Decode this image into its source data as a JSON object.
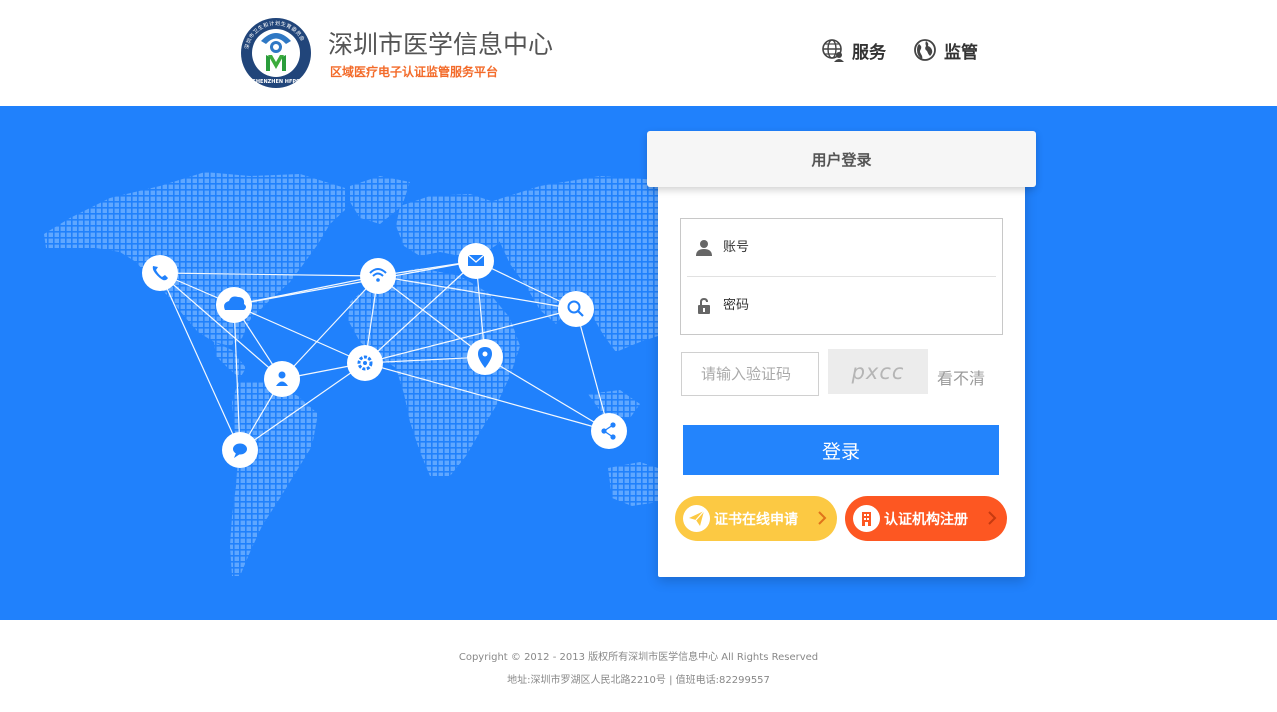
{
  "header": {
    "logo_ring_text": "深圳市卫生和计划生育委员会",
    "logo_bottom_text": "SHENZHEN HFPC",
    "title": "深圳市医学信息中心",
    "subtitle": "区域医疗电子认证监管服务平台",
    "nav": [
      {
        "label": "服务",
        "icon": "globe-user-icon"
      },
      {
        "label": "监管",
        "icon": "globe-icon"
      }
    ]
  },
  "login": {
    "title": "用户登录",
    "username_placeholder": "账号",
    "password_placeholder": "密码",
    "captcha_placeholder": "请输入验证码",
    "captcha_text": "pxcc",
    "refresh_label": "看不清",
    "submit_label": "登录",
    "apply_label": "证书在线申请",
    "register_label": "认证机构注册"
  },
  "footer": {
    "copyright": "Copyright © 2012 - 2013 版权所有深圳市医学信息中心 All Rights Reserved",
    "address": "地址:深圳市罗湖区人民北路2210号 | 值班电话:82299557"
  },
  "colors": {
    "banner": "#2081fc",
    "button": "#2384fc",
    "apply": "#fcc943",
    "register": "#fd5722",
    "subtitle": "#f36b2a"
  }
}
